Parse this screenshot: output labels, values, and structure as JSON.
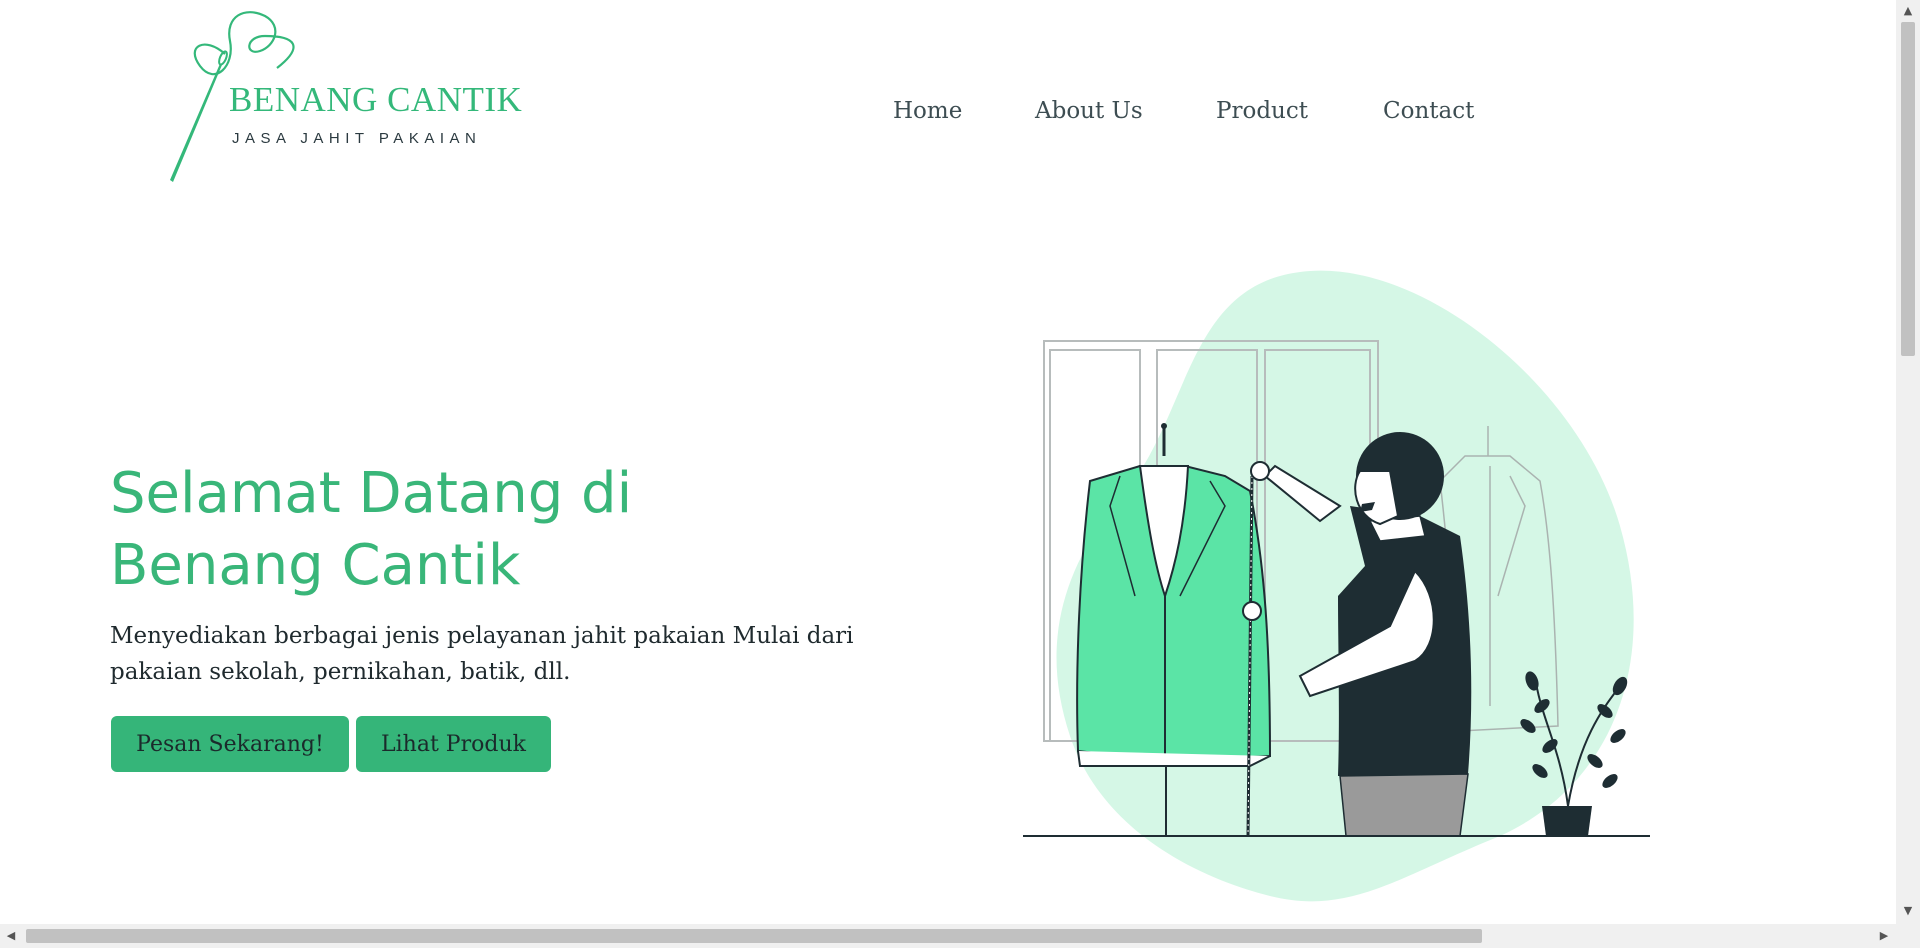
{
  "brand": {
    "name": "BENANG CANTIK",
    "tagline": "JASA JAHIT PAKAIAN",
    "color": "#34b87a"
  },
  "nav": {
    "items": [
      {
        "label": "Home"
      },
      {
        "label": "About Us"
      },
      {
        "label": "Product"
      },
      {
        "label": "Contact"
      }
    ]
  },
  "hero": {
    "title_line1": "Selamat Datang di",
    "title_line2": "Benang Cantik",
    "description": "Menyediakan berbagai jenis pelayanan jahit pakaian Mulai dari pakaian sekolah, pernikahan, batik, dll.",
    "primary_button": "Pesan Sekarang!",
    "secondary_button": "Lihat Produk"
  },
  "colors": {
    "accent": "#35b579",
    "title": "#39b679",
    "blob": "#d5f7e6",
    "jacket": "#5be4a6",
    "ink": "#1e2d33"
  },
  "icons": {
    "scroll_up": "up-arrow-icon",
    "scroll_down": "down-arrow-icon",
    "scroll_left": "left-arrow-icon",
    "scroll_right": "right-arrow-icon"
  }
}
